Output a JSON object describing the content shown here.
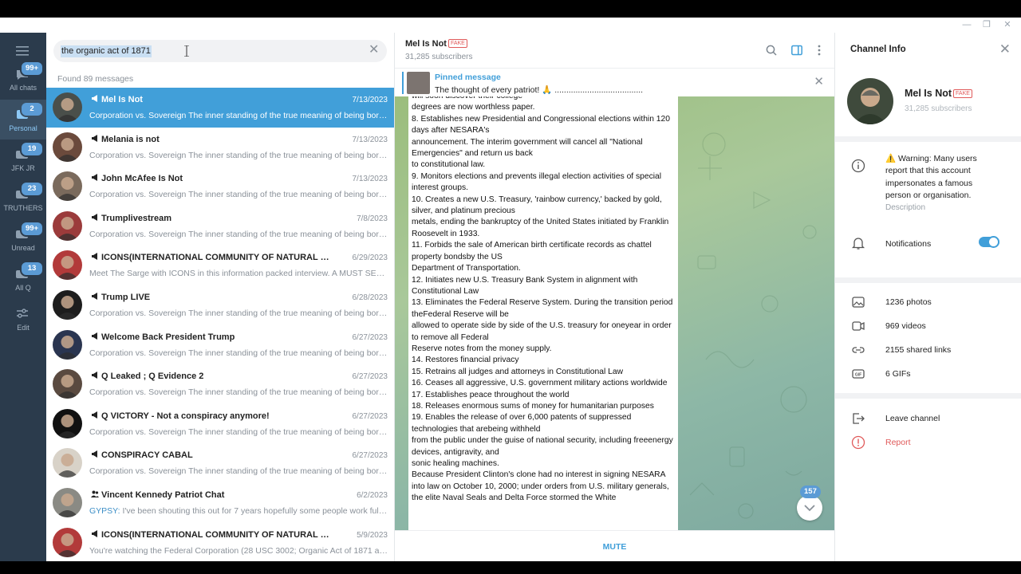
{
  "window": {
    "minimize": "—",
    "restore": "❐",
    "close": "✕"
  },
  "folders": [
    {
      "label": "All chats",
      "badge": "99+"
    },
    {
      "label": "Personal",
      "badge": "2"
    },
    {
      "label": "JFK JR",
      "badge": "19"
    },
    {
      "label": "TRUTHERS",
      "badge": "23"
    },
    {
      "label": "Unread",
      "badge": "99+"
    },
    {
      "label": "All Q",
      "badge": "13"
    },
    {
      "label": "Edit",
      "badge": ""
    }
  ],
  "search": {
    "query": "the organic act of 1871",
    "found": "Found 89 messages"
  },
  "results": [
    {
      "name": "Mel Is Not",
      "date": "7/13/2023",
      "sender": "",
      "preview": "Corporation vs. Sovereign  The inner standing of the true meaning of being born…",
      "icon": "megaphone-icon",
      "avatar_color": "#4a4f4a"
    },
    {
      "name": "Melania is not",
      "date": "7/13/2023",
      "sender": "",
      "preview": "Corporation vs. Sovereign  The inner standing of the true meaning of being born…",
      "icon": "megaphone-icon",
      "avatar_color": "#6b4a3c"
    },
    {
      "name": "John McAfee Is Not",
      "date": "7/13/2023",
      "sender": "",
      "preview": "Corporation vs. Sovereign  The inner standing of the true meaning of being born…",
      "icon": "megaphone-icon",
      "avatar_color": "#7a6a5c"
    },
    {
      "name": "Trumplivestream",
      "date": "7/8/2023",
      "sender": "",
      "preview": "Corporation vs. Sovereign  The inner standing of the true meaning of being born…",
      "icon": "megaphone-icon",
      "avatar_color": "#9b3b3b"
    },
    {
      "name": "ICONS(INTERNATIONAL COMMUNITY OF NATURAL SOVEREIGNS)",
      "date": "6/29/2023",
      "sender": "",
      "preview": "Meet The Sarge with ICONS in this information packed interview.   A MUST SEE…",
      "icon": "megaphone-icon",
      "avatar_color": "#b23a3a"
    },
    {
      "name": "Trump LIVE",
      "date": "6/28/2023",
      "sender": "",
      "preview": "Corporation vs. Sovereign  The inner standing of the true meaning of being born…",
      "icon": "megaphone-icon",
      "avatar_color": "#1d1d1d"
    },
    {
      "name": "Welcome Back President Trump",
      "date": "6/27/2023",
      "sender": "",
      "preview": "Corporation vs. Sovereign  The inner standing of the true meaning of being born…",
      "icon": "megaphone-icon",
      "avatar_color": "#2a3550"
    },
    {
      "name": "Q Leaked ; Q Evidence 2",
      "date": "6/27/2023",
      "sender": "",
      "preview": "Corporation vs. Sovereign  The inner standing of the true meaning of being born…",
      "icon": "megaphone-icon",
      "avatar_color": "#5a4a40"
    },
    {
      "name": "Q VICTORY - Not a conspiracy anymore!",
      "date": "6/27/2023",
      "sender": "",
      "preview": "Corporation vs. Sovereign  The inner standing of the true meaning of being born…",
      "icon": "megaphone-icon",
      "avatar_color": "#111111"
    },
    {
      "name": "CONSPIRACY CABAL",
      "date": "6/27/2023",
      "sender": "",
      "preview": "Corporation vs. Sovereign  The inner standing of the true meaning of being born…",
      "icon": "megaphone-icon",
      "avatar_color": "#d8d2c8"
    },
    {
      "name": "Vincent Kennedy Patriot Chat",
      "date": "6/2/2023",
      "sender": "GYPSY: ",
      "preview": "I've been shouting this out for 7 years hopefully some people work fully…",
      "icon": "group-icon",
      "avatar_color": "#8a8a84"
    },
    {
      "name": "ICONS(INTERNATIONAL COMMUNITY OF NATURAL SOVEREIGNS)",
      "date": "5/9/2023",
      "sender": "",
      "preview": "You're watching the Federal Corporation (28 USC 3002; Organic Act of 1871 and…",
      "icon": "megaphone-icon",
      "avatar_color": "#b23a3a"
    }
  ],
  "chat": {
    "title": "Mel Is Not",
    "fake_tag": "FAKE",
    "subscribers": "31,285 subscribers",
    "pinned_label": "Pinned message",
    "pinned_text": "The thought of every patriot! 🙏 ......................................",
    "message": "will soon discover their college\ndegrees are now worthless paper.\n8. Establishes new Presidential and Congressional elections within 120 days after NESARA's\nannouncement. The interim government will cancel all \"National Emergencies\" and return us back\nto constitutional law.\n9. Monitors elections and prevents illegal election activities of special interest groups.\n10. Creates a new U.S. Treasury, 'rainbow currency,' backed by gold, silver, and platinum precious\nmetals, ending the bankruptcy of the United States initiated by Franklin Roosevelt in 1933.\n11. Forbids the sale of American birth certificate records as chattel property bondsby the US\nDepartment of Transportation.\n12. Initiates new U.S. Treasury Bank System in alignment with Constitutional Law\n13. Eliminates the Federal Reserve System. During the transition period theFederal Reserve will be\nallowed to operate side by side of the U.S. treasury for oneyear in order to remove all Federal\nReserve notes from the money supply.\n14. Restores financial privacy\n15. Retrains all judges and attorneys in Constitutional Law\n16. Ceases all aggressive, U.S. government military actions worldwide\n17. Establishes peace throughout the world\n18. Releases enormous sums of money for humanitarian purposes\n19. Enables the release of over 6,000 patents of suppressed technologies that arebeing withheld\nfrom the public under the guise of national security, including freeenergy devices, antigravity, and\nsonic healing machines.\nBecause President Clinton's clone had no interest in signing NESARA into law on October 10, 2000; under orders from U.S. military generals, the elite Naval Seals and Delta Force stormed the White",
    "unread_count": "157",
    "footer_action": "MUTE"
  },
  "info": {
    "header": "Channel Info",
    "name": "Mel Is Not",
    "fake_tag": "FAKE",
    "subscribers": "31,285 subscribers",
    "warning": "⚠️ Warning: Many users report that this account impersonates a famous person or organisation.",
    "description_label": "Description",
    "notifications_label": "Notifications",
    "notifications_on": true,
    "media": [
      {
        "label": "1236 photos",
        "icon": "photo-icon"
      },
      {
        "label": "969 videos",
        "icon": "video-icon"
      },
      {
        "label": "2155 shared links",
        "icon": "link-icon"
      },
      {
        "label": "6 GIFs",
        "icon": "gif-icon"
      }
    ],
    "leave_label": "Leave channel",
    "report_label": "Report"
  },
  "colors": {
    "accent": "#419fd9",
    "sidebar": "#2b3b4c",
    "warning_red": "#e05a5a"
  }
}
